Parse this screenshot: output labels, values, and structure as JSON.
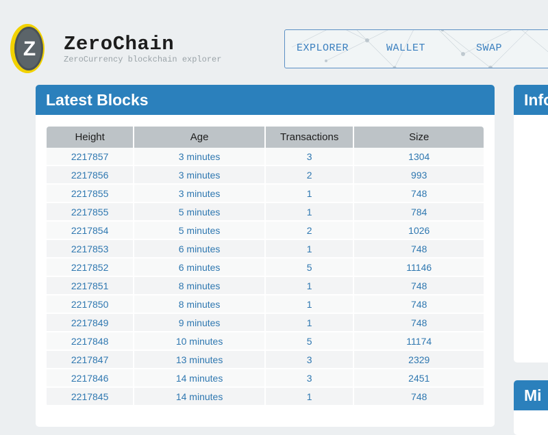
{
  "brand": {
    "title": "ZeroChain",
    "subtitle": "ZeroCurrency blockchain explorer",
    "logo_letter": "Z"
  },
  "nav": {
    "items": [
      {
        "label": "EXPLORER"
      },
      {
        "label": "WALLET"
      },
      {
        "label": "SWAP"
      }
    ]
  },
  "latest_blocks": {
    "title": "Latest Blocks",
    "columns": [
      "Height",
      "Age",
      "Transactions",
      "Size"
    ],
    "rows": [
      {
        "height": "2217857",
        "age": "3 minutes",
        "transactions": "3",
        "size": "1304"
      },
      {
        "height": "2217856",
        "age": "3 minutes",
        "transactions": "2",
        "size": "993"
      },
      {
        "height": "2217855",
        "age": "3 minutes",
        "transactions": "1",
        "size": "748"
      },
      {
        "height": "2217855",
        "age": "5 minutes",
        "transactions": "1",
        "size": "784"
      },
      {
        "height": "2217854",
        "age": "5 minutes",
        "transactions": "2",
        "size": "1026"
      },
      {
        "height": "2217853",
        "age": "6 minutes",
        "transactions": "1",
        "size": "748"
      },
      {
        "height": "2217852",
        "age": "6 minutes",
        "transactions": "5",
        "size": "11146"
      },
      {
        "height": "2217851",
        "age": "8 minutes",
        "transactions": "1",
        "size": "748"
      },
      {
        "height": "2217850",
        "age": "8 minutes",
        "transactions": "1",
        "size": "748"
      },
      {
        "height": "2217849",
        "age": "9 minutes",
        "transactions": "1",
        "size": "748"
      },
      {
        "height": "2217848",
        "age": "10 minutes",
        "transactions": "5",
        "size": "11174"
      },
      {
        "height": "2217847",
        "age": "13 minutes",
        "transactions": "3",
        "size": "2329"
      },
      {
        "height": "2217846",
        "age": "14 minutes",
        "transactions": "3",
        "size": "2451"
      },
      {
        "height": "2217845",
        "age": "14 minutes",
        "transactions": "1",
        "size": "748"
      }
    ]
  },
  "side_panels": {
    "info_title": "Info",
    "mining_title": "Mi"
  },
  "colors": {
    "panel_header": "#2b80bc",
    "link": "#2e77b0",
    "nav_link": "#3a7fbf",
    "logo_ring": "#f2d200"
  }
}
